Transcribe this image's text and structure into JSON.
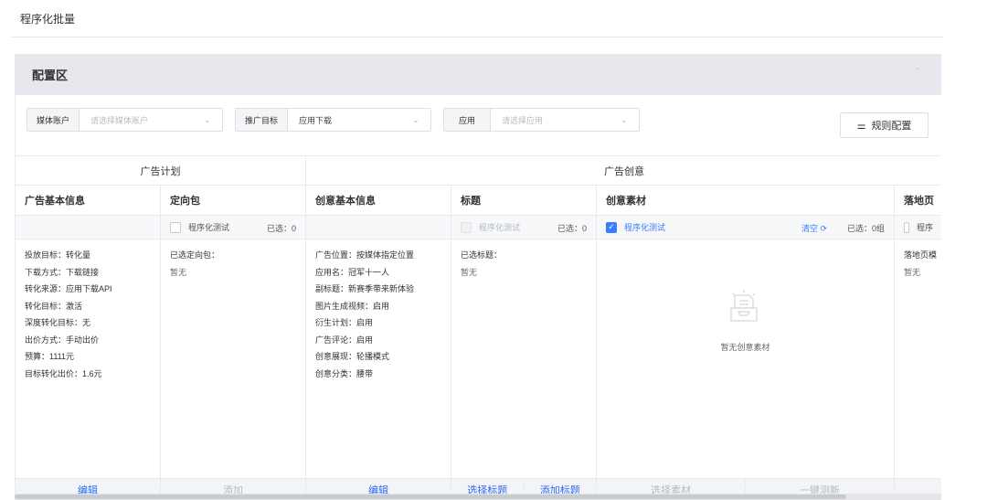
{
  "page": {
    "title": "程序化批量"
  },
  "panel": {
    "title": "配置区",
    "collapse_icon": "chevron-up-icon"
  },
  "filters": {
    "media_account": {
      "label": "媒体账户",
      "placeholder": "请选择媒体账户"
    },
    "promo_goal": {
      "label": "推广目标",
      "value": "应用下载"
    },
    "app": {
      "label": "应用",
      "placeholder": "请选择应用"
    },
    "rule_button": "规则配置"
  },
  "groups": {
    "plan": "广告计划",
    "creative": "广告创意"
  },
  "columns": {
    "basic": {
      "header": "广告基本信息",
      "lines": [
        "投放目标：转化量",
        "下载方式：下载链接",
        "转化来源：应用下载API",
        "转化目标：激活",
        "深度转化目标：无",
        "出价方式：手动出价",
        "预算：1111元",
        "目标转化出价：1.6元"
      ],
      "footer": [
        "编辑"
      ]
    },
    "targeting": {
      "header": "定向包",
      "sub_label": "程序化测试",
      "sub_count": "已选：0",
      "lines": [
        "已选定向包：",
        "暂无"
      ],
      "footer": [
        "添加"
      ]
    },
    "creative_basic": {
      "header": "创意基本信息",
      "lines": [
        "广告位置：按媒体指定位置",
        "应用名：冠军十一人",
        "副标题：新赛季带来新体验",
        "图片生成视频：启用",
        "衍生计划：启用",
        "广告评论：启用",
        "创意展现：轮播模式",
        "创意分类：腰带"
      ],
      "footer": [
        "编辑"
      ]
    },
    "title": {
      "header": "标题",
      "sub_label": "程序化测试",
      "sub_count": "已选：0",
      "lines": [
        "已选标题：",
        "暂无"
      ],
      "footer": [
        "选择标题",
        "添加标题"
      ]
    },
    "material": {
      "header": "创意素材",
      "sub_label": "程序化测试",
      "sub_clear": "清空 ⟳",
      "sub_count": "已选：0组",
      "empty_text": "暂无创意素材",
      "footer": [
        "选择素材",
        "一键测新"
      ]
    },
    "landing": {
      "header": "落地页",
      "sub_label": "程序",
      "lines": [
        "落地页模",
        "暂无"
      ]
    }
  }
}
